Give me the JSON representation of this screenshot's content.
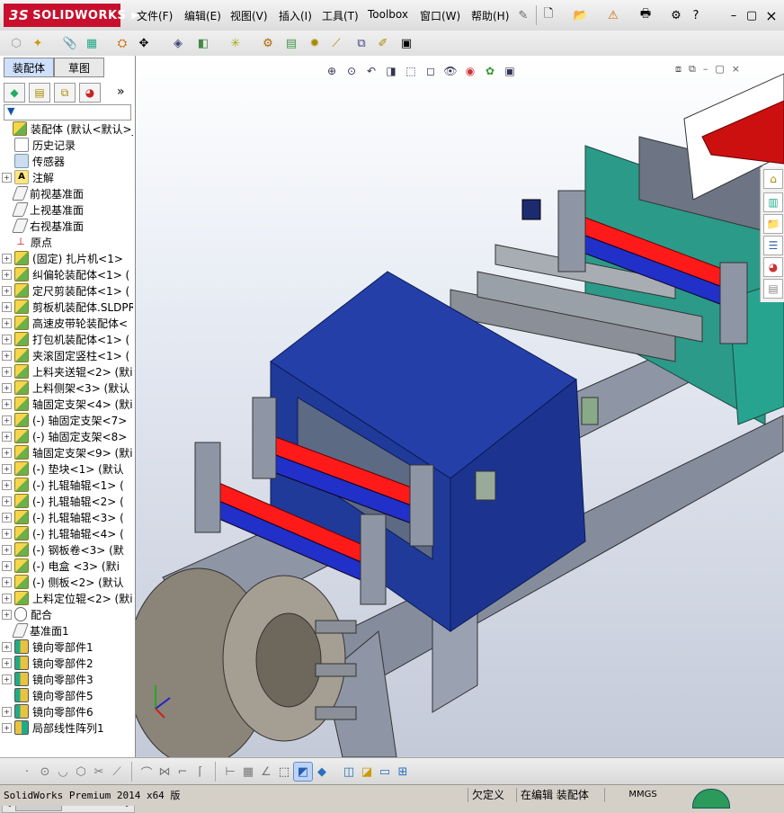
{
  "app": {
    "brand": "SOLIDWORKS",
    "brand_prefix": "3S"
  },
  "menu": [
    "文件(F)",
    "编辑(E)",
    "视图(V)",
    "插入(I)",
    "工具(T)",
    "Toolbox",
    "窗口(W)",
    "帮助(H)"
  ],
  "window_controls": {
    "minimize": "–",
    "restore": "▢",
    "close": "×"
  },
  "panel_tabs": [
    "装配体",
    "草图"
  ],
  "manager_expand": "»",
  "filter_icon": "filter-icon",
  "tree": [
    {
      "label": "装配体    (默认<默认>_",
      "icon": "asm",
      "expand": "none"
    },
    {
      "label": "历史记录",
      "icon": "history",
      "expand": "none",
      "indent": 1
    },
    {
      "label": "传感器",
      "icon": "sensor",
      "expand": "none",
      "indent": 1
    },
    {
      "label": "注解",
      "icon": "note",
      "expand": "+",
      "indent": 0
    },
    {
      "label": "前视基准面",
      "icon": "plane",
      "expand": "none",
      "indent": 1
    },
    {
      "label": "上视基准面",
      "icon": "plane",
      "expand": "none",
      "indent": 1
    },
    {
      "label": "右视基准面",
      "icon": "plane",
      "expand": "none",
      "indent": 1
    },
    {
      "label": "原点",
      "icon": "origin",
      "expand": "none",
      "indent": 1
    },
    {
      "label": "(固定) 扎片机<1>",
      "icon": "asm",
      "expand": "+"
    },
    {
      "label": "纠偏轮装配体<1>  (",
      "icon": "asm",
      "expand": "+"
    },
    {
      "label": "定尺剪装配体<1>  (",
      "icon": "asm",
      "expand": "+"
    },
    {
      "label": "剪板机装配体.SLDPR",
      "icon": "asm",
      "expand": "+"
    },
    {
      "label": "高速皮带轮装配体<",
      "icon": "asm",
      "expand": "+"
    },
    {
      "label": "打包机装配体<1>  (",
      "icon": "asm",
      "expand": "+"
    },
    {
      "label": "夹滚固定竖柱<1>  (",
      "icon": "asm",
      "expand": "+"
    },
    {
      "label": "上料夹送辊<2>  (默i",
      "icon": "asm",
      "expand": "+"
    },
    {
      "label": "上料侧架<3>  (默认",
      "icon": "asm",
      "expand": "+"
    },
    {
      "label": "轴固定支架<4>  (默i",
      "icon": "asm",
      "expand": "+"
    },
    {
      "label": "(-) 轴固定支架<7>",
      "icon": "asm",
      "expand": "+"
    },
    {
      "label": "(-) 轴固定支架<8>",
      "icon": "asm",
      "expand": "+"
    },
    {
      "label": "轴固定支架<9>  (默i",
      "icon": "asm",
      "expand": "+"
    },
    {
      "label": "(-) 垫块<1>  (默认",
      "icon": "asm",
      "expand": "+"
    },
    {
      "label": "(-) 扎辊轴辊<1>  (",
      "icon": "asm",
      "expand": "+"
    },
    {
      "label": "(-) 扎辊轴辊<2>  (",
      "icon": "asm",
      "expand": "+"
    },
    {
      "label": "(-) 扎辊轴辊<3>  (",
      "icon": "asm",
      "expand": "+"
    },
    {
      "label": "(-) 扎辊轴辊<4>  (",
      "icon": "asm",
      "expand": "+"
    },
    {
      "label": "(-) 钢板卷<3>  (默",
      "icon": "asm",
      "expand": "+"
    },
    {
      "label": "(-) 电盒  <3>  (默i",
      "icon": "asm",
      "expand": "+"
    },
    {
      "label": "(-) 侧板<2>  (默认",
      "icon": "asm",
      "expand": "+"
    },
    {
      "label": "上料定位辊<2>  (默i",
      "icon": "asm",
      "expand": "+"
    },
    {
      "label": "配合",
      "icon": "mate",
      "expand": "+"
    },
    {
      "label": "基准面1",
      "icon": "plane",
      "expand": "none",
      "indent": 1
    },
    {
      "label": "镜向零部件1",
      "icon": "mirror",
      "expand": "+"
    },
    {
      "label": "镜向零部件2",
      "icon": "mirror",
      "expand": "+"
    },
    {
      "label": "镜向零部件3",
      "icon": "mirror",
      "expand": "+"
    },
    {
      "label": "镜向零部件5",
      "icon": "mirror",
      "expand": "none",
      "indent": 1
    },
    {
      "label": "镜向零部件6",
      "icon": "mirror",
      "expand": "+"
    },
    {
      "label": "局部线性阵列1",
      "icon": "pattern",
      "expand": "+"
    }
  ],
  "status": {
    "version": "SolidWorks Premium 2014 x64 版",
    "defined": "欠定义",
    "editing": "在编辑 装配体",
    "units": "MMGS"
  },
  "colors": {
    "cover_blue": "#1f3a99",
    "roller_red": "#ff1a1a",
    "roller_blue": "#2030c8",
    "frame_gray": "#8e96a6"
  }
}
